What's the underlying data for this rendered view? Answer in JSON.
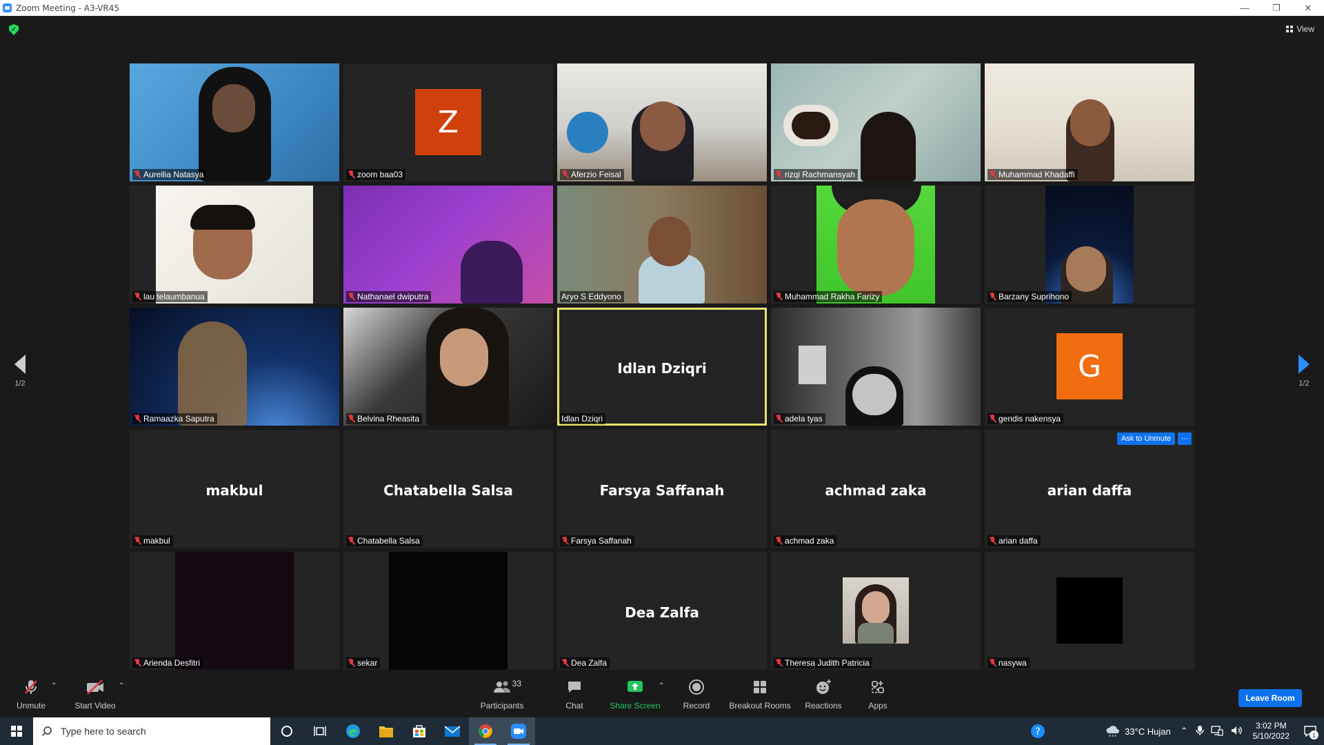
{
  "window": {
    "title": "Zoom Meeting - A3-VR45"
  },
  "header": {
    "view_label": "View"
  },
  "pagination": {
    "left": "1/2",
    "right": "1/2"
  },
  "colors": {
    "accent": "#0e72ed",
    "active_speaker": "#e8e56a",
    "mute_red": "#e0383e",
    "share_green": "#22c55e"
  },
  "tiles": [
    {
      "name": "Aurellia Natasya",
      "type": "video",
      "muted": true
    },
    {
      "name": "zoom baa03",
      "type": "avatar",
      "initial": "Z",
      "avatar_color": "#d0400b",
      "muted": true
    },
    {
      "name": "Aferzio Feisal",
      "type": "video",
      "muted": true
    },
    {
      "name": "rizqi Rachmansyah",
      "type": "video",
      "muted": true
    },
    {
      "name": "Muhammad Khadaffi",
      "type": "video",
      "muted": true
    },
    {
      "name": "lau telaumbanua",
      "type": "video",
      "muted": true
    },
    {
      "name": "Nathanael dwiputra",
      "type": "video",
      "muted": true
    },
    {
      "name": "Aryo S Eddyono",
      "type": "video",
      "muted": false
    },
    {
      "name": "Muhammad Rakha Farizy",
      "type": "video",
      "muted": true
    },
    {
      "name": "Barzany Suprihono",
      "type": "video",
      "muted": true
    },
    {
      "name": "Ramaazka Saputra",
      "type": "video",
      "muted": true
    },
    {
      "name": "Belvina Rheasita",
      "type": "video",
      "muted": true
    },
    {
      "name": "Idlan Dziqri",
      "type": "name",
      "display_name": "Idlan Dziqri",
      "muted": false,
      "active": true
    },
    {
      "name": "adela tyas",
      "type": "video",
      "muted": true
    },
    {
      "name": "gendis nakensya",
      "type": "avatar",
      "initial": "G",
      "avatar_color": "#f26d0f",
      "muted": true
    },
    {
      "name": "makbul",
      "type": "name",
      "display_name": "makbul",
      "muted": true
    },
    {
      "name": "Chatabella Salsa",
      "type": "name",
      "display_name": "Chatabella Salsa",
      "muted": true
    },
    {
      "name": "Farsya Saffanah",
      "type": "name",
      "display_name": "Farsya Saffanah",
      "muted": true
    },
    {
      "name": "achmad zaka",
      "type": "name",
      "display_name": "achmad zaka",
      "muted": true
    },
    {
      "name": "arian daffa",
      "type": "name",
      "display_name": "arian daffa",
      "muted": true,
      "ask_unmute": "Ask to Unmute",
      "more": "···"
    },
    {
      "name": "Arienda Desfitri",
      "type": "video",
      "muted": true
    },
    {
      "name": "sekar",
      "type": "video",
      "muted": true
    },
    {
      "name": "Dea Zalfa",
      "type": "name",
      "display_name": "Dea Zalfa",
      "muted": true
    },
    {
      "name": "Theresa Judith Patricia",
      "type": "photo",
      "muted": true
    },
    {
      "name": "nasywa",
      "type": "video",
      "muted": true
    }
  ],
  "toolbar": {
    "unmute": "Unmute",
    "start_video": "Start Video",
    "participants": "Participants",
    "participants_count": "33",
    "chat": "Chat",
    "share_screen": "Share Screen",
    "record": "Record",
    "breakout_rooms": "Breakout Rooms",
    "reactions": "Reactions",
    "apps": "Apps",
    "leave": "Leave Room"
  },
  "taskbar": {
    "search_placeholder": "Type here to search",
    "weather": "33°C  Hujan",
    "time": "3:02 PM",
    "date": "5/10/2022",
    "notification_count": "1"
  }
}
